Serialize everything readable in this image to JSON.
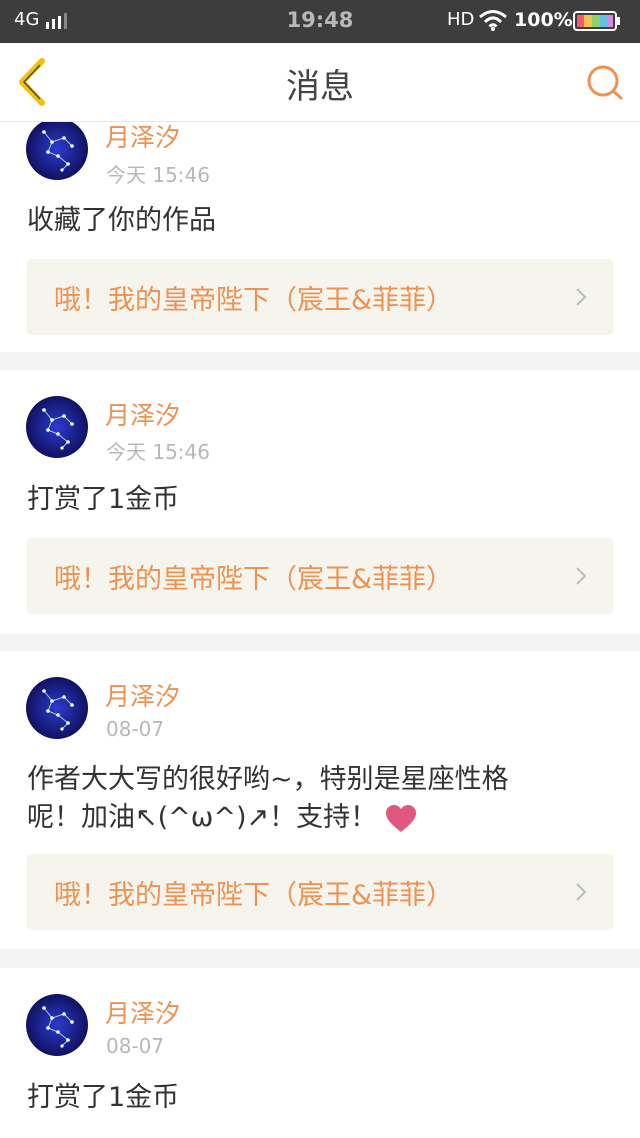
{
  "status_bar": {
    "network": "4G",
    "time": "19:48",
    "hd": "HD",
    "battery": "100%"
  },
  "nav": {
    "title": "消息"
  },
  "messages": [
    {
      "name": "月泽汐",
      "time": "今天 15:46",
      "content": "收藏了你的作品",
      "work_title": "哦！我的皇帝陛下（宸王&菲菲）"
    },
    {
      "name": "月泽汐",
      "time": "今天 15:46",
      "content": "打赏了1金币",
      "work_title": "哦！我的皇帝陛下（宸王&菲菲）"
    },
    {
      "name": "月泽汐",
      "time": "08-07",
      "content_line1": "作者大大写的很好哟~，特别是星座性格",
      "content_line2": "呢！加油↖(^ω^)↗！支持！",
      "work_title": "哦！我的皇帝陛下（宸王&菲菲）"
    },
    {
      "name": "月泽汐",
      "time": "08-07",
      "content": "打赏了1金币"
    }
  ],
  "colors": {
    "accent": "#ef9151",
    "back_icon": "#f2c200",
    "heart": "#e0577f"
  }
}
